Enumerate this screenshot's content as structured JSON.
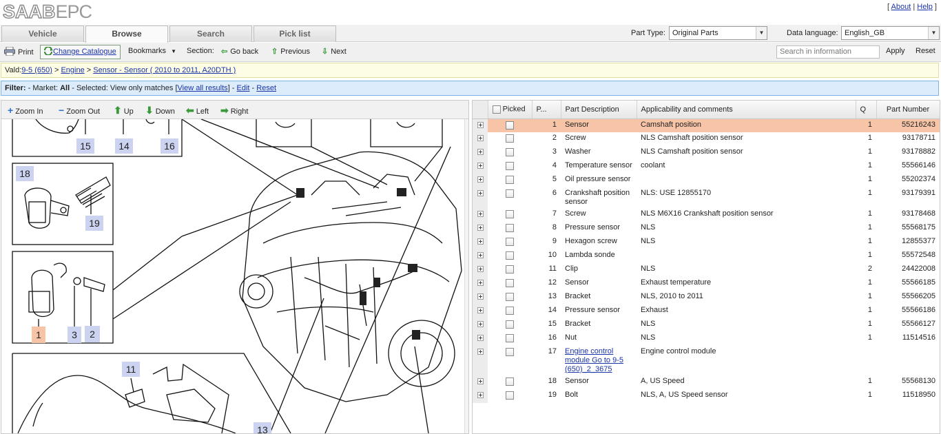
{
  "header": {
    "logo_brand": "SAAB",
    "logo_epc": "EPC",
    "about": "About",
    "help": "Help"
  },
  "tabs": [
    {
      "label": "Vehicle"
    },
    {
      "label": "Browse",
      "active": true
    },
    {
      "label": "Search"
    },
    {
      "label": "Pick list"
    }
  ],
  "part_type": {
    "label": "Part Type:",
    "value": "Original Parts"
  },
  "data_language": {
    "label": "Data language:",
    "value": "English_GB"
  },
  "toolbar": {
    "print": "Print",
    "change_catalogue": "Change Catalogue",
    "bookmarks": "Bookmarks",
    "section": "Section:",
    "go_back": "Go back",
    "previous": "Previous",
    "next": "Next",
    "search_placeholder": "Search in information",
    "apply": "Apply",
    "reset": "Reset"
  },
  "breadcrumb": {
    "prefix": "Vald:",
    "model": "9-5 (650)",
    "group": "Engine",
    "section": "Sensor - Sensor ( 2010 to 2011, A20DTH )"
  },
  "filter": {
    "label": "Filter:",
    "market_label": "- Market:",
    "market_value": "All",
    "selected_label": "- Selected:",
    "selected_value": "View only matches",
    "view_all": "View all results",
    "edit": "Edit",
    "reset": "Reset"
  },
  "zoom": {
    "zoom_in": "Zoom In",
    "zoom_out": "Zoom Out",
    "up": "Up",
    "down": "Down",
    "left": "Left",
    "right": "Right"
  },
  "diagram_callouts": [
    "15",
    "14",
    "16",
    "18",
    "19",
    "1",
    "3",
    "2",
    "11",
    "13"
  ],
  "table": {
    "headers": {
      "picked": "Picked",
      "pos": "P...",
      "description": "Part Description",
      "applicability": "Applicability and comments",
      "qty": "Q",
      "part_number": "Part Number"
    },
    "rows": [
      {
        "pos": "1",
        "desc": "Sensor",
        "app": "Camshaft position",
        "qty": "1",
        "pn": "55216243",
        "selected": true
      },
      {
        "pos": "2",
        "desc": "Screw",
        "app": "NLS Camshaft position sensor",
        "qty": "1",
        "pn": "93178711"
      },
      {
        "pos": "3",
        "desc": "Washer",
        "app": "NLS Camshaft position sensor",
        "qty": "1",
        "pn": "93178882"
      },
      {
        "pos": "4",
        "desc": "Temperature sensor",
        "app": "coolant",
        "qty": "1",
        "pn": "55566146"
      },
      {
        "pos": "5",
        "desc": "Oil pressure sensor",
        "app": "",
        "qty": "1",
        "pn": "55202374"
      },
      {
        "pos": "6",
        "desc": "Crankshaft position sensor",
        "app": "NLS: USE 12855170",
        "qty": "1",
        "pn": "93179391"
      },
      {
        "pos": "7",
        "desc": "Screw",
        "app": "NLS M6X16 Crankshaft position sensor",
        "qty": "1",
        "pn": "93178468"
      },
      {
        "pos": "8",
        "desc": "Pressure sensor",
        "app": "NLS",
        "qty": "1",
        "pn": "55568175"
      },
      {
        "pos": "9",
        "desc": "Hexagon screw",
        "app": "NLS",
        "qty": "1",
        "pn": "12855377"
      },
      {
        "pos": "10",
        "desc": "Lambda sonde",
        "app": "",
        "qty": "1",
        "pn": "55572548"
      },
      {
        "pos": "11",
        "desc": "Clip",
        "app": "NLS",
        "qty": "2",
        "pn": "24422008"
      },
      {
        "pos": "12",
        "desc": "Sensor",
        "app": "Exhaust temperature",
        "qty": "1",
        "pn": "55566185"
      },
      {
        "pos": "13",
        "desc": "Bracket",
        "app": "NLS, 2010 to 2011",
        "qty": "1",
        "pn": "55566205"
      },
      {
        "pos": "14",
        "desc": "Pressure sensor",
        "app": "Exhaust",
        "qty": "1",
        "pn": "55566186"
      },
      {
        "pos": "15",
        "desc": "Bracket",
        "app": "NLS",
        "qty": "1",
        "pn": "55566127"
      },
      {
        "pos": "16",
        "desc": "Nut",
        "app": "NLS",
        "qty": "1",
        "pn": "11514516"
      },
      {
        "pos": "17",
        "desc": "Engine control module Go to 9-5 (650)_2_3675",
        "app": "Engine control module",
        "qty": "",
        "pn": "",
        "link": true
      },
      {
        "pos": "18",
        "desc": "Sensor",
        "app": "A, US Speed",
        "qty": "1",
        "pn": "55568130"
      },
      {
        "pos": "19",
        "desc": "Bolt",
        "app": "NLS, A, US Speed sensor",
        "qty": "1",
        "pn": "11518950"
      }
    ]
  }
}
